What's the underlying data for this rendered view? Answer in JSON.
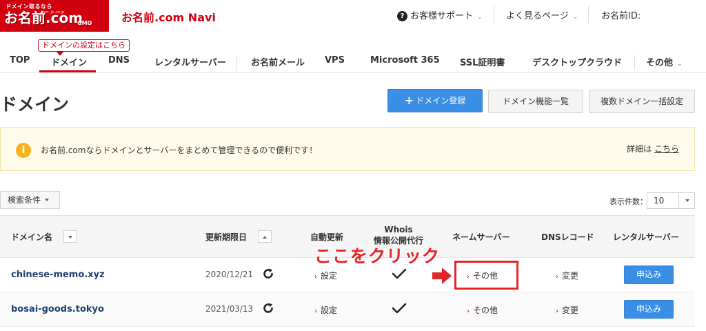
{
  "logo": {
    "tagline": "ドメイン取るなら",
    "name": "お名前.com",
    "subdomains": ".com .jp .co.jp",
    "gmo": "GMO"
  },
  "header": {
    "brand": "お名前.com Navi",
    "support": "お客様サポート",
    "faq": "よく見るページ",
    "user_id_label": "お名前ID:"
  },
  "nav": {
    "tooltip": "ドメインの設定はこちら",
    "items": [
      "TOP",
      "ドメイン",
      "DNS",
      "レンタルサーバー",
      "お名前メール",
      "VPS",
      "Microsoft 365",
      "SSL証明書",
      "デスクトップクラウド",
      "その他"
    ],
    "active": "ドメイン"
  },
  "page": {
    "title": "ドメイン",
    "register_button": "ドメイン登録",
    "feature_list_button": "ドメイン機能一覧",
    "bulk_settings_button": "複数ドメイン一括設定"
  },
  "info": {
    "message": "お名前.comならドメインとサーバーをまとめて管理できるので便利です！",
    "detail_label": "詳細は",
    "detail_link": "こちら"
  },
  "filter": {
    "search_conditions": "検索条件",
    "count_label": "表示件数：",
    "count_value": "10"
  },
  "table": {
    "headers": {
      "domain": "ドメイン名",
      "expiry": "更新期限日",
      "auto_renew": "自動更新",
      "whois_line1": "Whois",
      "whois_line2": "情報公開代行",
      "nameserver": "ネームサーバー",
      "dns_record": "DNSレコード",
      "rental_server": "レンタルサーバー"
    },
    "rows": [
      {
        "domain": "chinese-memo.xyz",
        "expiry": "2020/12/21",
        "auto_renew": "設定",
        "nameserver": "その他",
        "dns": "変更",
        "rental": "申込み"
      },
      {
        "domain": "bosai-goods.tokyo",
        "expiry": "2021/03/13",
        "auto_renew": "設定",
        "nameserver": "その他",
        "dns": "変更",
        "rental": "申込み"
      }
    ]
  },
  "annotation": {
    "text": "ここをクリック",
    "color": "#e5242a"
  },
  "colors": {
    "brand_red": "#d1000f",
    "primary_blue": "#3a8ee6",
    "info_bg": "#fffbea",
    "info_icon": "#f7b21c"
  }
}
